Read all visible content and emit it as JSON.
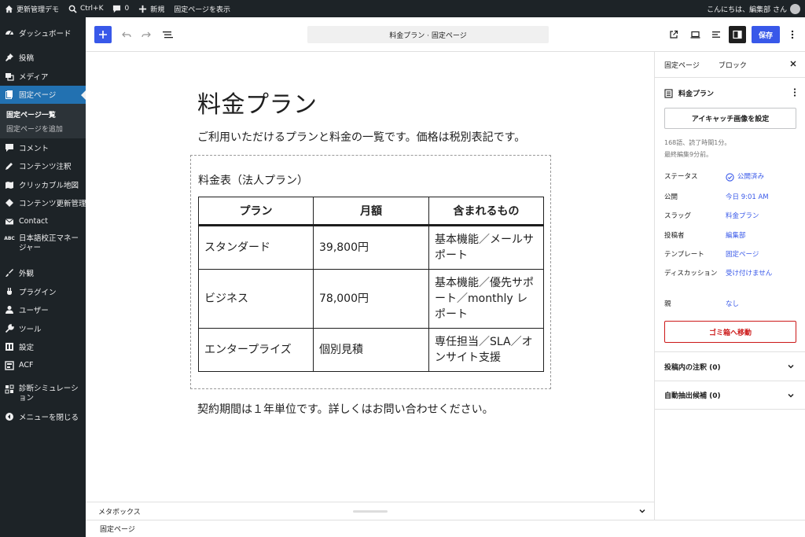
{
  "admin_bar": {
    "site_name": "更新管理デモ",
    "shortcut": "Ctrl+K",
    "comments_count": "0",
    "new_label": "新規",
    "view_page": "固定ページを表示",
    "greeting": "こんにちは、編集部 さん"
  },
  "sidebar": {
    "dashboard": "ダッシュボード",
    "posts": "投稿",
    "media": "メディア",
    "pages": "固定ページ",
    "pages_list": "固定ページ一覧",
    "pages_add": "固定ページを追加",
    "comments": "コメント",
    "content_notes": "コンテンツ注釈",
    "clickable_map": "クリッカブル地図",
    "content_update": "コンテンツ更新管理",
    "contact": "Contact",
    "proofreading": "日本語校正マネージャー",
    "appearance": "外観",
    "plugins": "プラグイン",
    "users": "ユーザー",
    "tools": "ツール",
    "settings": "設定",
    "acf": "ACF",
    "simulation": "診断シミュレーション",
    "collapse": "メニューを閉じる"
  },
  "header": {
    "doc_title": "料金プラン · 固定ページ",
    "save_label": "保存"
  },
  "content": {
    "title": "料金プラン",
    "intro": "ご利用いただけるプランと料金の一覧です。価格は税別表記です。",
    "table_caption": "料金表（法人プラン）",
    "columns": [
      "プラン",
      "月額",
      "含まれるもの"
    ],
    "rows": [
      [
        "スタンダード",
        "39,800円",
        "基本機能／メールサポート"
      ],
      [
        "ビジネス",
        "78,000円",
        "基本機能／優先サポート／monthly レポート"
      ],
      [
        "エンタープライズ",
        "個別見積",
        "専任担当／SLA／オンサイト支援"
      ]
    ],
    "contract_note": "契約期間は１年単位です。詳しくはお問い合わせください。"
  },
  "panel": {
    "tab_page": "固定ページ",
    "tab_block": "ブロック",
    "page_name": "料金プラン",
    "featured_image": "アイキャッチ画像を設定",
    "word_info": "168語、読了時間1分。",
    "last_edited": "最終編集9分前。",
    "status_label": "ステータス",
    "status_value": "公開済み",
    "publish_label": "公開",
    "publish_value": "今日 9:01 AM",
    "slug_label": "スラッグ",
    "slug_value": "料金プラン",
    "author_label": "投稿者",
    "author_value": "編集部",
    "template_label": "テンプレート",
    "template_value": "固定ページ",
    "discussion_label": "ディスカッション",
    "discussion_value": "受け付けません",
    "parent_label": "親",
    "parent_value": "なし",
    "trash": "ゴミ箱へ移動",
    "acc1": "投稿内の注釈 (0)",
    "acc2": "自動抽出候補 (0)"
  },
  "metabox": {
    "label": "メタボックス"
  },
  "footer": {
    "breadcrumb": "固定ページ"
  },
  "colors": {
    "accent": "#3858e9",
    "admin_dark": "#1d2327",
    "menu_active": "#2271b1",
    "danger": "#cc1818"
  }
}
